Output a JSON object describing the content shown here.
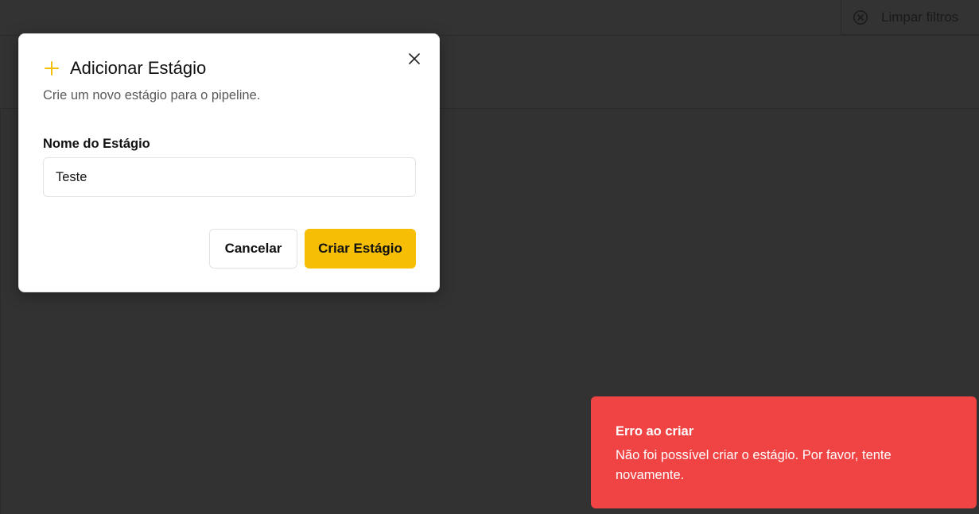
{
  "toolbar": {
    "clear_filters_label": "Limpar filtros"
  },
  "modal": {
    "title": "Adicionar Estágio",
    "subtitle": "Crie um novo estágio para o pipeline.",
    "field_label": "Nome do Estágio",
    "field_value": "Teste",
    "cancel_label": "Cancelar",
    "create_label": "Criar Estágio"
  },
  "toast": {
    "title": "Erro ao criar",
    "message": "Não foi possível criar o estágio. Por favor, tente novamente."
  },
  "colors": {
    "accent": "#f6bf06",
    "error": "#ef4344",
    "backdrop": "#313131"
  },
  "icons": {
    "close": "close-icon",
    "plus": "plus-icon",
    "clear": "x-circle-icon"
  }
}
